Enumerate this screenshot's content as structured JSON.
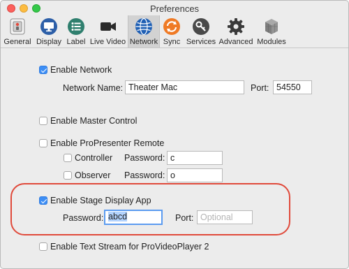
{
  "window": {
    "title": "Preferences"
  },
  "toolbar": {
    "items": [
      {
        "label": "General",
        "icon": "switch-icon"
      },
      {
        "label": "Display",
        "icon": "monitor-icon"
      },
      {
        "label": "Label",
        "icon": "list-icon"
      },
      {
        "label": "Live Video",
        "icon": "video-camera-icon"
      },
      {
        "label": "Network",
        "icon": "globe-icon",
        "selected": true
      },
      {
        "label": "Sync",
        "icon": "sync-icon"
      },
      {
        "label": "Services",
        "icon": "key-icon"
      },
      {
        "label": "Advanced",
        "icon": "gear-icon"
      },
      {
        "label": "Modules",
        "icon": "cubes-icon"
      }
    ]
  },
  "network": {
    "enable_label": "Enable Network",
    "enabled": true,
    "name_label": "Network Name:",
    "name_value": "Theater Mac",
    "port_label": "Port:",
    "port_value": "54550"
  },
  "master_control": {
    "label": "Enable Master Control",
    "enabled": false
  },
  "remote": {
    "label": "Enable ProPresenter Remote",
    "enabled": false,
    "controller": {
      "label": "Controller",
      "enabled": false,
      "password_label": "Password:",
      "password_value": "c"
    },
    "observer": {
      "label": "Observer",
      "enabled": false,
      "password_label": "Password:",
      "password_value": "o"
    }
  },
  "stage_display": {
    "label": "Enable Stage Display App",
    "enabled": true,
    "password_label": "Password:",
    "password_value": "abcd",
    "port_label": "Port:",
    "port_placeholder": "Optional"
  },
  "text_stream": {
    "label": "Enable Text Stream for ProVideoPlayer 2",
    "enabled": false
  },
  "colors": {
    "accent": "#3d8ef5",
    "callout": "#e04a3b"
  }
}
